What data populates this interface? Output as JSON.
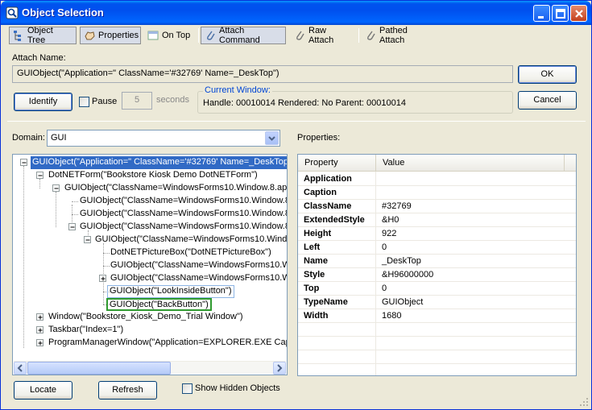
{
  "window": {
    "title": "Object Selection"
  },
  "toolbar": {
    "object_tree": "Object Tree",
    "properties": "Properties",
    "on_top": "On Top",
    "attach_command": "Attach Command",
    "raw_attach": "Raw Attach",
    "pathed_attach": "Pathed Attach"
  },
  "attach": {
    "label": "Attach Name:",
    "value": "GUIObject(\"Application=\" ClassName='#32769' Name=_DeskTop\")",
    "ok": "OK",
    "cancel": "Cancel"
  },
  "identify": {
    "button": "Identify",
    "pause_label": "Pause",
    "pause_checked": false,
    "seconds_value": "5",
    "seconds_label": "seconds"
  },
  "current_window": {
    "title": "Current Window:",
    "info": "Handle: 00010014 Rendered: No  Parent: 00010014"
  },
  "domain": {
    "label": "Domain:",
    "value": "GUI"
  },
  "tree": {
    "nodes": [
      {
        "text": "GUIObject(\"Application=\" ClassName='#32769' Name=_DeskTop\")",
        "state": "selected"
      },
      {
        "text": "DotNETForm(\"Bookstore Kiosk Demo DotNETForm\")",
        "state": ""
      },
      {
        "text": "GUIObject(\"ClassName=WindowsForms10.Window.8.app",
        "state": ""
      },
      {
        "text": "GUIObject(\"ClassName=WindowsForms10.Window.8.",
        "state": ""
      },
      {
        "text": "GUIObject(\"ClassName=WindowsForms10.Window.8.",
        "state": ""
      },
      {
        "text": "GUIObject(\"ClassName=WindowsForms10.Window.8.",
        "state": ""
      },
      {
        "text": "GUIObject(\"ClassName=WindowsForms10.Window",
        "state": ""
      },
      {
        "text": "DotNETPictureBox(\"DotNETPictureBox\")",
        "state": ""
      },
      {
        "text": "GUIObject(\"ClassName=WindowsForms10.Win",
        "state": ""
      },
      {
        "text": "GUIObject(\"ClassName=WindowsForms10.Win",
        "state": ""
      },
      {
        "text": "GUIObject(\"LookInsideButton\")",
        "state": "hover"
      },
      {
        "text": "GUIObject(\"BackButton\")",
        "state": "highlight"
      },
      {
        "text": "Window(\"Bookstore_Kiosk_Demo_Trial Window\")",
        "state": ""
      },
      {
        "text": "Taskbar(\"Index=1\")",
        "state": ""
      },
      {
        "text": "ProgramManagerWindow(\"Application=EXPLORER.EXE Caption",
        "state": ""
      }
    ]
  },
  "properties": {
    "label": "Properties:",
    "col_property": "Property",
    "col_value": "Value",
    "rows": [
      {
        "key": "Application",
        "value": ""
      },
      {
        "key": "Caption",
        "value": ""
      },
      {
        "key": "ClassName",
        "value": "#32769"
      },
      {
        "key": "ExtendedStyle",
        "value": "&H0"
      },
      {
        "key": "Height",
        "value": "922"
      },
      {
        "key": "Left",
        "value": "0"
      },
      {
        "key": "Name",
        "value": "_DeskTop"
      },
      {
        "key": "Style",
        "value": "&H96000000"
      },
      {
        "key": "Top",
        "value": "0"
      },
      {
        "key": "TypeName",
        "value": "GUIObject"
      },
      {
        "key": "Width",
        "value": "1680"
      }
    ]
  },
  "footer": {
    "locate": "Locate",
    "refresh": "Refresh",
    "show_hidden": "Show Hidden Objects"
  },
  "colors": {
    "title_bar": "#0054e3",
    "selection": "#316ac5",
    "highlight_green": "#2f9a2f",
    "group_title": "#0046d5"
  }
}
